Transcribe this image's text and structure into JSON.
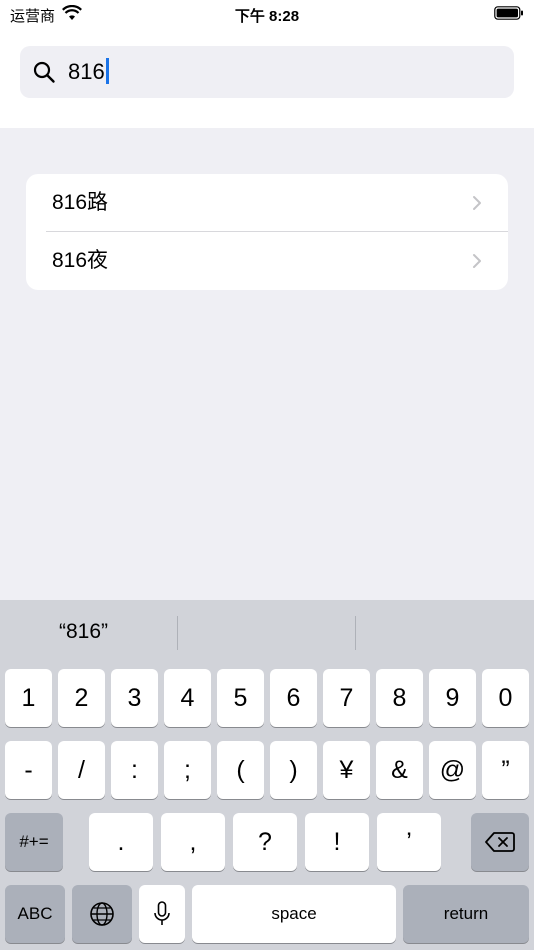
{
  "status_bar": {
    "carrier": "运营商",
    "time": "下午 8:28"
  },
  "search": {
    "value": "816"
  },
  "results": [
    {
      "label": "816路"
    },
    {
      "label": "816夜"
    }
  ],
  "keyboard": {
    "suggestion": "“816”",
    "row1": [
      "1",
      "2",
      "3",
      "4",
      "5",
      "6",
      "7",
      "8",
      "9",
      "0"
    ],
    "row2": [
      "-",
      "/",
      ":",
      ";",
      "(",
      ")",
      "¥",
      "&",
      "@",
      "”"
    ],
    "row3": [
      ".",
      ",",
      "?",
      "!",
      "’"
    ],
    "symbols_toggle": "#+=",
    "abc_toggle": "ABC",
    "space": "space",
    "return": "return"
  }
}
